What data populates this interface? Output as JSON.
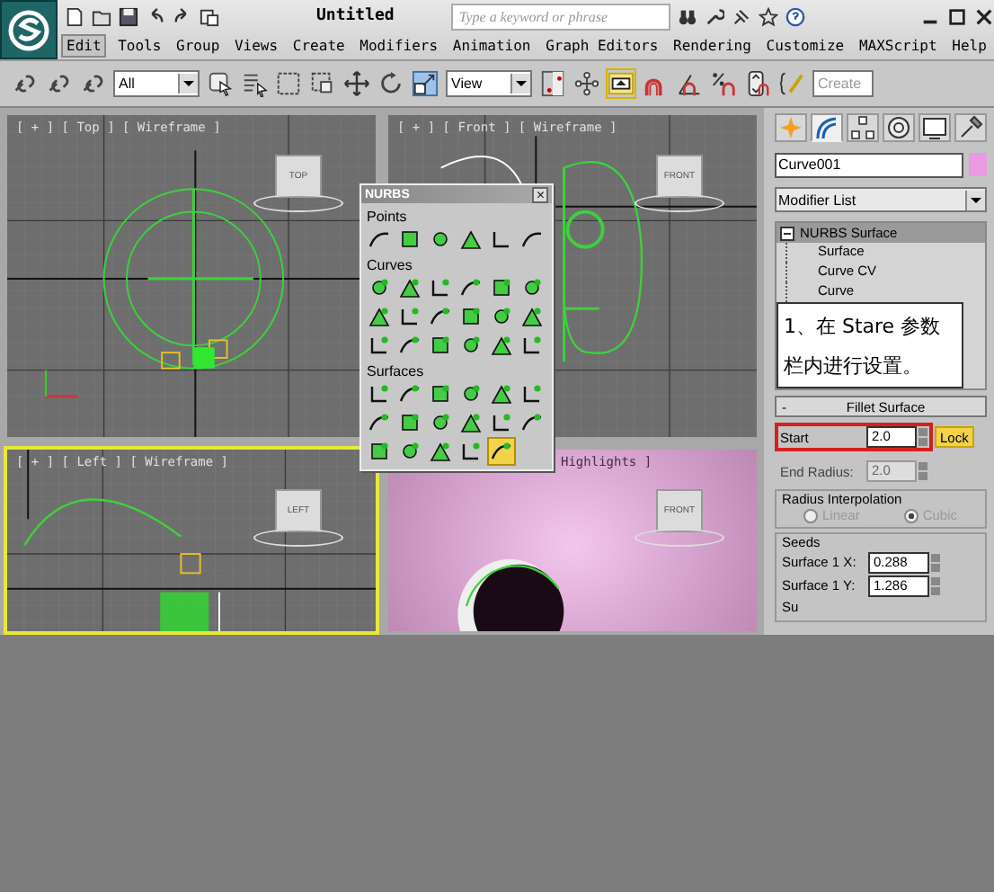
{
  "app": {
    "title": "Untitled",
    "search": {
      "placeholder": "Type a keyword or phrase"
    }
  },
  "menu": [
    {
      "label": "Edit",
      "selected": true
    },
    {
      "label": "Tools",
      "selected": false
    },
    {
      "label": "Group",
      "selected": false
    },
    {
      "label": "Views",
      "selected": false
    },
    {
      "label": "Create",
      "selected": false
    },
    {
      "label": "Modifiers",
      "selected": false
    },
    {
      "label": "Animation",
      "selected": false
    },
    {
      "label": "Graph Editors",
      "selected": false
    },
    {
      "label": "Rendering",
      "selected": false
    },
    {
      "label": "Customize",
      "selected": false
    },
    {
      "label": "MAXScript",
      "selected": false
    },
    {
      "label": "Help",
      "selected": false
    }
  ],
  "toolbar": {
    "selection_filter": "All",
    "reference_coord": "View",
    "named_selection": "Create"
  },
  "viewports": [
    {
      "label": "[ + ] [ Top ] [ Wireframe ]",
      "active": false,
      "kind": "top",
      "cube": "TOP"
    },
    {
      "label": "[ + ] [ Front ] [ Wireframe ]",
      "active": false,
      "kind": "front",
      "cube": "FRONT"
    },
    {
      "label": "[ + ] [ Left ] [ Wireframe ]",
      "active": true,
      "kind": "left",
      "cube": "LEFT"
    },
    {
      "label": "Highlights ]",
      "active": false,
      "kind": "perspective",
      "cube": "FRONT"
    }
  ],
  "nurbs_panel": {
    "title": "NURBS",
    "close": "×",
    "sections": [
      {
        "title": "Points",
        "tools": [
          {
            "selected": false
          },
          {
            "selected": false
          },
          {
            "selected": false
          },
          {
            "selected": false
          },
          {
            "selected": false
          },
          {
            "selected": false
          }
        ]
      },
      {
        "title": "Curves",
        "tools": [
          {
            "selected": false
          },
          {
            "selected": false
          },
          {
            "selected": false
          },
          {
            "selected": false
          },
          {
            "selected": false
          },
          {
            "selected": false
          },
          {
            "selected": false
          },
          {
            "selected": false
          },
          {
            "selected": false
          },
          {
            "selected": false
          },
          {
            "selected": false
          },
          {
            "selected": false
          },
          {
            "selected": false
          },
          {
            "selected": false
          },
          {
            "selected": false
          },
          {
            "selected": false
          },
          {
            "selected": false
          },
          {
            "selected": false
          }
        ]
      },
      {
        "title": "Surfaces",
        "tools": [
          {
            "selected": false
          },
          {
            "selected": false
          },
          {
            "selected": false
          },
          {
            "selected": false
          },
          {
            "selected": false
          },
          {
            "selected": false
          },
          {
            "selected": false
          },
          {
            "selected": false
          },
          {
            "selected": false
          },
          {
            "selected": false
          },
          {
            "selected": false
          },
          {
            "selected": false
          },
          {
            "selected": false
          },
          {
            "selected": false
          },
          {
            "selected": false
          },
          {
            "selected": false
          },
          {
            "selected": true
          }
        ]
      }
    ]
  },
  "command_panel": {
    "tabs": [
      {
        "kind": "create",
        "selected": false
      },
      {
        "kind": "modify",
        "selected": true
      },
      {
        "kind": "hierarchy",
        "selected": false
      },
      {
        "kind": "motion",
        "selected": false
      },
      {
        "kind": "display",
        "selected": false
      },
      {
        "kind": "utilities",
        "selected": false
      }
    ],
    "object_name": "Curve001",
    "modifier_list": "Modifier List",
    "stack": [
      {
        "label": "NURBS Surface",
        "selected": true,
        "expanded": true,
        "children": [
          {
            "label": "Surface",
            "selected": false
          },
          {
            "label": "Curve CV",
            "selected": false
          },
          {
            "label": "Curve",
            "selected": false
          }
        ]
      }
    ],
    "rollout": {
      "toggle": "-",
      "title": "Fillet Surface",
      "fields": [
        {
          "label": "Start",
          "value": "2.0",
          "disabled": false,
          "highlighted": true
        },
        {
          "label": "End Radius:",
          "value": "2.0",
          "disabled": true,
          "highlighted": false
        }
      ],
      "lock": {
        "label": "Lock",
        "on": true
      },
      "radius_interpolation": {
        "title": "Radius Interpolation",
        "options": [
          {
            "label": "Linear",
            "selected": false,
            "disabled": true
          },
          {
            "label": "Cubic",
            "selected": true,
            "disabled": true
          }
        ]
      },
      "seeds": {
        "title": "Seeds",
        "fields": [
          {
            "label": "Surface 1 X:",
            "value": "0.288"
          },
          {
            "label": "Surface 1 Y:",
            "value": "1.286"
          },
          {
            "label": "Su"
          }
        ]
      }
    }
  },
  "callout": {
    "text": "1、在 Stare 参数栏内进行设置。"
  }
}
